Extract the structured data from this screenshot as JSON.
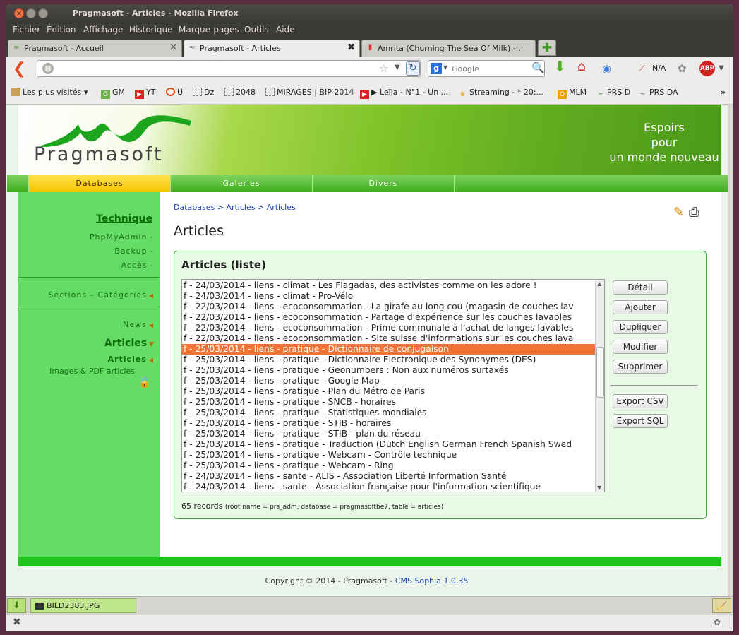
{
  "window": {
    "title": "Pragmasoft - Articles - Mozilla Firefox"
  },
  "menu": [
    "Fichier",
    "Édition",
    "Affichage",
    "Historique",
    "Marque-pages",
    "Outils",
    "Aide"
  ],
  "tabs": [
    {
      "label": "Pragmasoft - Accueil"
    },
    {
      "label": "Pragmasoft - Articles"
    },
    {
      "label": "Amrita (Churning The Sea Of Milk) -..."
    }
  ],
  "nav": {
    "url": "",
    "search_placeholder": "Google",
    "na_label": "N/A"
  },
  "bookmarks": [
    "Les plus visités ▾",
    "GM",
    "YT",
    "U",
    "Dz",
    "2048",
    "MIRAGES | BIP 2014",
    "▶ Leïla - N°1 - Un ...",
    "Streaming - * 20:...",
    "MLM",
    "PRS D",
    "PRS DA"
  ],
  "site": {
    "logo": "Pragmasoft",
    "tagline": [
      "Espoirs",
      "pour",
      "un monde nouveau"
    ],
    "navtabs": [
      "Databases",
      "Galeries",
      "Divers"
    ],
    "sidebar": {
      "heading": "Technique",
      "items": [
        "PhpMyAdmin",
        "Backup",
        "Accès"
      ],
      "sections": "Sections – Catégories",
      "news": "News",
      "articles_h": "Articles",
      "articles_sub": "Articles",
      "images": "Images & PDF articles"
    },
    "breadcrumb": [
      "Databases",
      "Articles",
      "Articles"
    ],
    "page_title": "Articles",
    "panel_title": "Articles (liste)",
    "list": [
      "f - 24/03/2014 - liens - climat - Les Flagadas, des activistes comme on les adore !",
      "f - 24/03/2014 - liens - climat - Pro-Vélo",
      "f - 22/03/2014 - liens - ecoconsommation - La girafe au long cou (magasin de couches lav",
      "f - 22/03/2014 - liens - ecoconsommation - Partage d'expérience sur les couches lavables",
      "f - 22/03/2014 - liens - ecoconsommation - Prime communale à l'achat de langes lavables",
      "f - 22/03/2014 - liens - ecoconsommation - Site suisse d'informations sur les couches lava",
      "f - 25/03/2014 - liens - pratique - Dictionnaire de conjugaison",
      "f - 25/03/2014 - liens - pratique - Dictionnaire Electronique des Synonymes (DES)",
      "f - 25/03/2014 - liens - pratique - Geonumbers : Non aux numéros surtaxés",
      "f - 25/03/2014 - liens - pratique - Google Map",
      "f - 25/03/2014 - liens - pratique - Plan du Métro de Paris",
      "f - 25/03/2014 - liens - pratique - SNCB - horaires",
      "f - 25/03/2014 - liens - pratique - Statistiques mondiales",
      "f - 25/03/2014 - liens - pratique - STIB - horaires",
      "f - 25/03/2014 - liens - pratique - STIB - plan du réseau",
      "f - 25/03/2014 - liens - pratique - Traduction (Dutch English German French Spanish Swed",
      "f - 25/03/2014 - liens - pratique - Webcam - Contrôle technique",
      "f - 25/03/2014 - liens - pratique - Webcam - Ring",
      "f - 24/03/2014 - liens - sante - ALIS - Association Liberté Information Santé",
      "f - 24/03/2014 - liens - sante - Association française pour l'information scientifique"
    ],
    "selected_index": 6,
    "buttons": [
      "Détail",
      "Ajouter",
      "Dupliquer",
      "Modifier",
      "Supprimer",
      "Export CSV",
      "Export SQL"
    ],
    "records": "65 records",
    "records_detail": "(root name = prs_adm, database = pragmasoftbe7, table = articles)",
    "copyright": "Copyright © 2014 - Pragmasoft - ",
    "cms": "CMS Sophia 1.0.35"
  },
  "download": {
    "file": "BILD2383.JPG"
  },
  "colors": {
    "accent": "#3cae1c",
    "selected": "#f07234",
    "nav_active": "#f4c400"
  }
}
